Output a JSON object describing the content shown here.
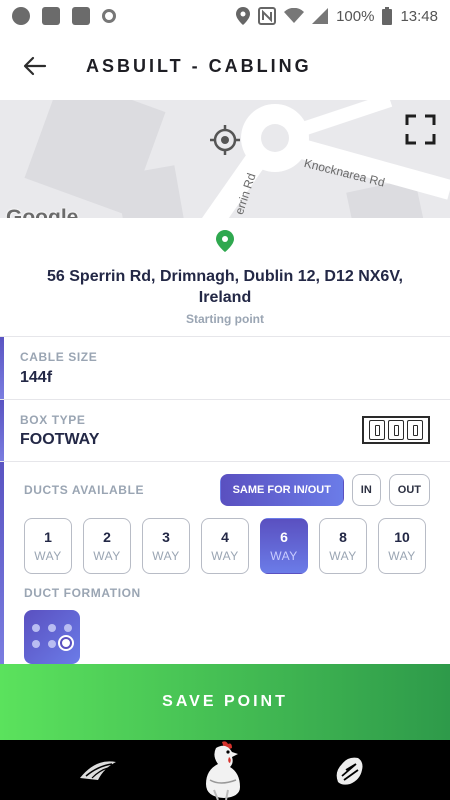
{
  "status_bar": {
    "battery": "100%",
    "time": "13:48"
  },
  "header": {
    "title": "ASBUILT - CABLING"
  },
  "map": {
    "road_1": "Knocknarea Rd",
    "road_2": "errin Rd",
    "brand": "Google"
  },
  "address": {
    "line1": "56 Sperrin Rd, Drimnagh, Dublin 12, D12 NX6V,",
    "line2": "Ireland",
    "subtitle": "Starting point"
  },
  "cable_size": {
    "label": "CABLE SIZE",
    "value": "144f"
  },
  "box_type": {
    "label": "BOX TYPE",
    "value": "FOOTWAY"
  },
  "ducts": {
    "label": "DUCTS AVAILABLE",
    "modes": [
      "SAME FOR IN/OUT",
      "IN",
      "OUT"
    ],
    "selected_mode": "SAME FOR IN/OUT",
    "ways": [
      {
        "n": "1",
        "w": "WAY"
      },
      {
        "n": "2",
        "w": "WAY"
      },
      {
        "n": "3",
        "w": "WAY"
      },
      {
        "n": "4",
        "w": "WAY"
      },
      {
        "n": "6",
        "w": "WAY"
      },
      {
        "n": "8",
        "w": "WAY"
      },
      {
        "n": "10",
        "w": "WAY"
      }
    ],
    "selected_way": "6"
  },
  "duct_formation": {
    "label": "DUCT FORMATION"
  },
  "save_button": {
    "label": "SAVE POINT"
  },
  "colors": {
    "accent": "#5a50c0",
    "save_start": "#5be25d",
    "save_end": "#2e9a4a"
  }
}
